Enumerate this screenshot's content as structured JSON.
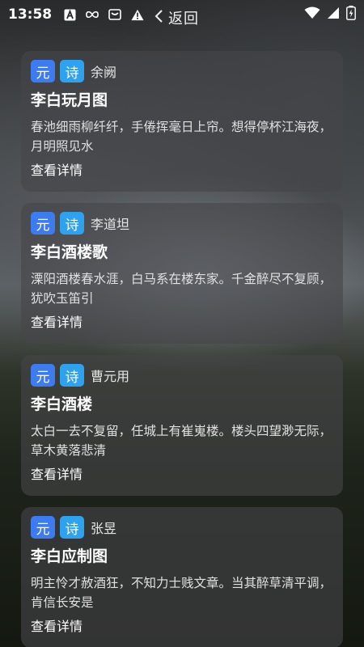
{
  "status": {
    "time": "13:58",
    "left_icons": [
      "a-badge-icon",
      "infinity-icon",
      "mail-box-icon",
      "warning-icon"
    ],
    "right_icons": [
      "wifi-icon",
      "signal-icon",
      "battery-icon"
    ]
  },
  "header": {
    "back_label": "返回"
  },
  "cards": [
    {
      "dynasty": "元",
      "type": "诗",
      "author": "余阙",
      "title": "李白玩月图",
      "excerpt": "春池细雨柳纤纤，手倦挥毫日上帘。想得停杯江海夜，月明照见水",
      "detail": "查看详情"
    },
    {
      "dynasty": "元",
      "type": "诗",
      "author": "李道坦",
      "title": "李白酒楼歌",
      "excerpt": "溧阳酒楼春水涯，白马系在楼东家。千金醉尽不复顾，犹吹玉笛引",
      "detail": "查看详情"
    },
    {
      "dynasty": "元",
      "type": "诗",
      "author": "曹元用",
      "title": "李白酒楼",
      "excerpt": "太白一去不复留，任城上有崔嵬楼。楼头四望渺无际，草木黄落悲清",
      "detail": "查看详情"
    },
    {
      "dynasty": "元",
      "type": "诗",
      "author": "张昱",
      "title": "李白应制图",
      "excerpt": "明主怜才赦酒狂，不知力士贱文章。当其醉草清平调，肯信长安是",
      "detail": "查看详情"
    }
  ],
  "colors": {
    "tag_dynasty": "#3d7cf0",
    "tag_type": "#2ea2ee"
  }
}
